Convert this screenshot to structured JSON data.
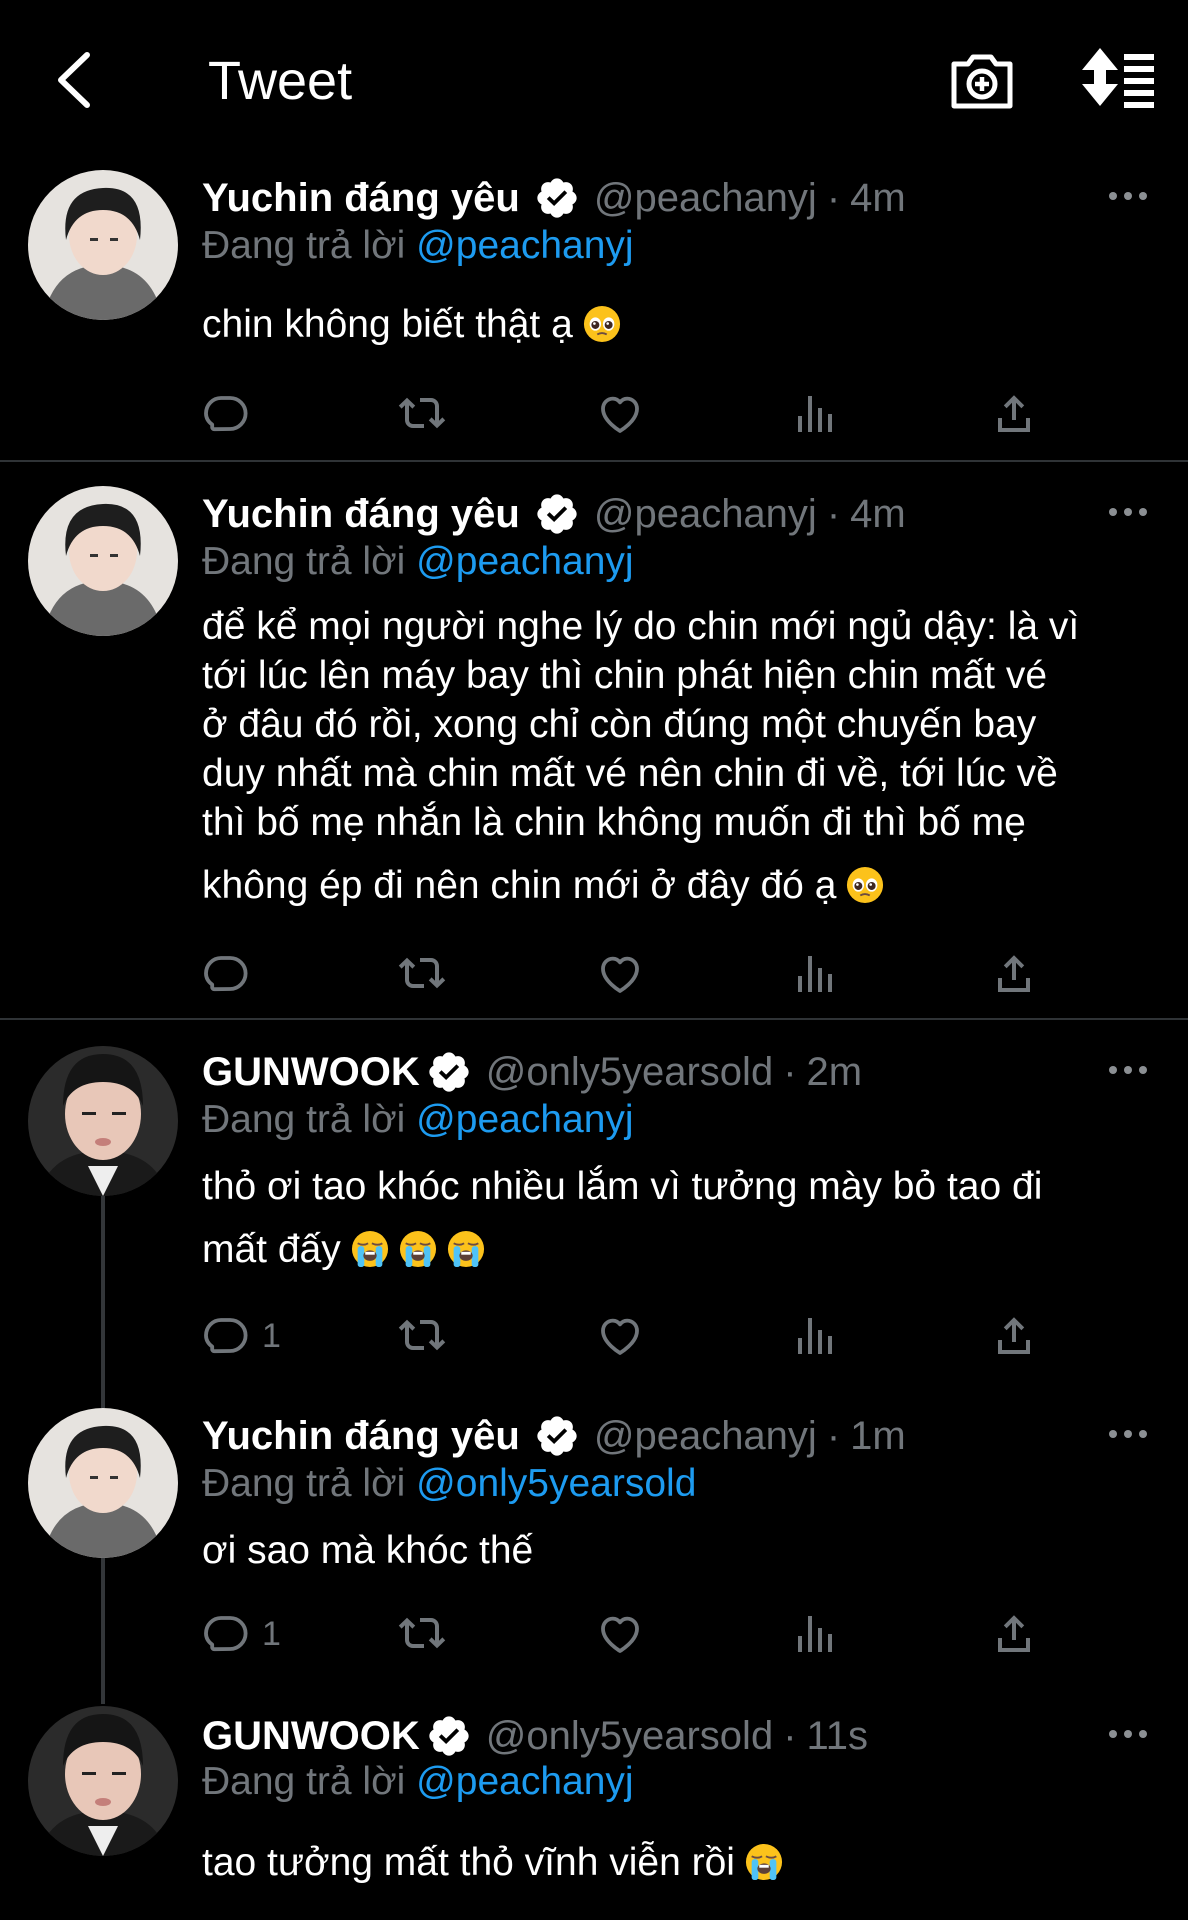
{
  "header": {
    "title": "Tweet"
  },
  "tweets": [
    {
      "name": "Yuchin đáng yêu",
      "handle": "@peachanyj",
      "time": "4m",
      "reply_prefix": "Đang trả lời",
      "reply_to": "@peachanyj",
      "text": "chin không biết thật ạ",
      "emoji": [
        "pleading-face"
      ],
      "reply_count": ""
    },
    {
      "name": "Yuchin đáng yêu",
      "handle": "@peachanyj",
      "time": "4m",
      "reply_prefix": "Đang trả lời",
      "reply_to": "@peachanyj",
      "text_lines": [
        "để kể mọi người nghe lý do chin mới ngủ dậy: là vì",
        "tới lúc lên máy bay thì chin phát hiện chin mất vé",
        "ở đâu đó rồi, xong chỉ còn đúng một chuyến bay",
        "duy nhất mà chin mất vé nên chin đi về, tới lúc về",
        "thì bố mẹ nhắn là chin không muốn đi thì bố mẹ",
        "không ép đi nên chin mới ở đây đó ạ"
      ],
      "emoji": [
        "pleading-face"
      ],
      "reply_count": ""
    },
    {
      "name": "GUNWOOK",
      "handle": "@only5yearsold",
      "time": "2m",
      "reply_prefix": "Đang trả lời",
      "reply_to": "@peachanyj",
      "text_lines": [
        "thỏ ơi tao khóc nhiều lắm vì tưởng mày bỏ tao đi",
        "mất đấy"
      ],
      "emoji": [
        "loudly-crying-face",
        "loudly-crying-face",
        "loudly-crying-face"
      ],
      "reply_count": "1"
    },
    {
      "name": "Yuchin đáng yêu",
      "handle": "@peachanyj",
      "time": "1m",
      "reply_prefix": "Đang trả lời",
      "reply_to": "@only5yearsold",
      "text": "ơi sao mà khóc thế",
      "emoji": [],
      "reply_count": "1"
    },
    {
      "name": "GUNWOOK",
      "handle": "@only5yearsold",
      "time": "11s",
      "reply_prefix": "Đang trả lời",
      "reply_to": "@peachanyj",
      "text": "tao tưởng mất thỏ vĩnh viễn rồi",
      "emoji": [
        "loudly-crying-face"
      ],
      "reply_count": ""
    }
  ],
  "icons": {
    "back": "back-arrow-icon",
    "camera": "camera-add-icon",
    "sort": "sort-icon",
    "reply": "reply-icon",
    "retweet": "retweet-icon",
    "like": "heart-icon",
    "analytics": "analytics-icon",
    "share": "share-icon",
    "more": "more-icon",
    "verified": "verified-badge-icon"
  },
  "colors": {
    "background": "#000000",
    "link": "#1d9bf0",
    "muted": "#71767b",
    "divider": "#2f3336"
  }
}
